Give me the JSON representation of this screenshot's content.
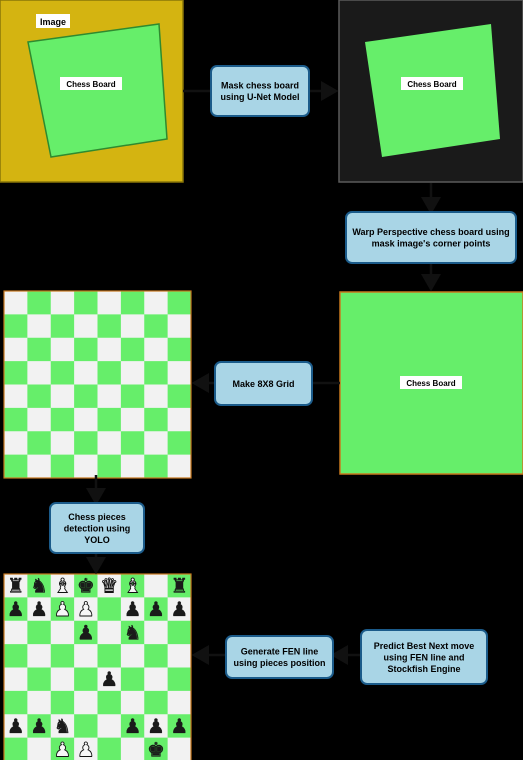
{
  "panels": {
    "input_image": {
      "tag": "Image",
      "board_label": "Chess Board",
      "bg": "#d4b411"
    },
    "masked_image": {
      "board_label": "Chess Board",
      "bg": "#1a1a1a"
    },
    "warped_image": {
      "board_label": "Chess Board"
    }
  },
  "steps": {
    "mask": [
      "Mask chess board",
      "using U-Net Model"
    ],
    "warp": [
      "Warp Perspective chess board using",
      "mask image's corner points"
    ],
    "grid": [
      "Make 8X8 Grid"
    ],
    "detect": [
      "Chess pieces",
      "detection using",
      "YOLO"
    ],
    "fen": [
      "Generate FEN line",
      "using pieces position"
    ],
    "predict": [
      "Predict Best Next move",
      "using FEN line and",
      "Stockfish Engine"
    ]
  },
  "colors": {
    "board_green": "#66ee6a",
    "square_light": "#f2f2f2",
    "step_fill": "#a9d5e6",
    "step_stroke": "#1b5b8a",
    "arrow": "#111111",
    "piece_black": "#1a1a1a",
    "piece_white": "#f6f6f6"
  },
  "board_pieces": [
    [
      "black-rook-icon",
      "black-knight-icon",
      "white-bishop-icon",
      "black-king-icon",
      "white-queen-icon",
      "white-bishop-icon",
      "",
      "black-rook-icon"
    ],
    [
      "black-pawn-icon",
      "black-pawn-icon",
      "white-pawn-icon",
      "white-pawn-icon",
      "",
      "black-pawn-icon",
      "black-pawn-icon",
      "black-pawn-icon"
    ],
    [
      "",
      "",
      "",
      "black-pawn-icon",
      "",
      "black-knight-icon",
      "",
      ""
    ],
    [
      "",
      "",
      "",
      "",
      "",
      "",
      "",
      ""
    ],
    [
      "",
      "",
      "",
      "",
      "black-pawn-icon",
      "",
      "",
      ""
    ],
    [
      "",
      "",
      "",
      "",
      "",
      "",
      "",
      ""
    ],
    [
      "black-pawn-icon",
      "black-pawn-icon",
      "black-knight-icon",
      "",
      "",
      "black-pawn-icon",
      "black-pawn-icon",
      "black-pawn-icon"
    ],
    [
      "",
      "",
      "white-pawn-icon",
      "white-pawn-icon",
      "",
      "",
      "black-king-icon",
      ""
    ]
  ]
}
